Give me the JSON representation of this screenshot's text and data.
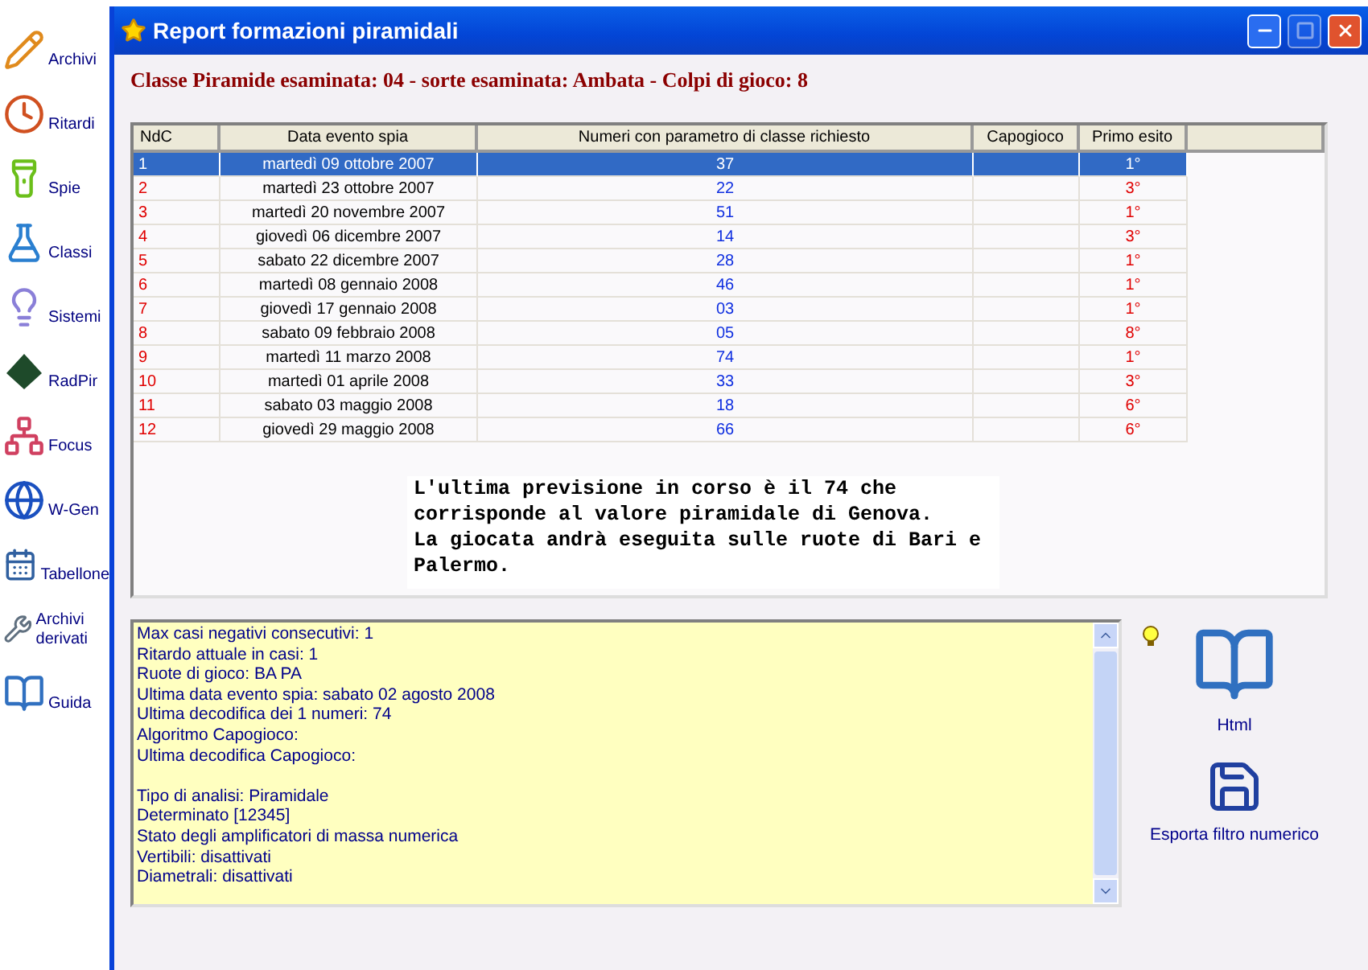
{
  "sidebar": {
    "items": [
      {
        "label": "Archivi"
      },
      {
        "label": "Ritardi"
      },
      {
        "label": "Spie"
      },
      {
        "label": "Classi"
      },
      {
        "label": "Sistemi"
      },
      {
        "label": "RadPir"
      },
      {
        "label": "Focus"
      },
      {
        "label": "W-Gen"
      },
      {
        "label": "Tabellone"
      },
      {
        "label": "Archivi derivati"
      },
      {
        "label": "Guida"
      }
    ]
  },
  "window": {
    "title": "Report formazioni piramidali",
    "buttons": [
      {
        "kind": "minimize",
        "disabled": false
      },
      {
        "kind": "maximize",
        "disabled": true
      },
      {
        "kind": "close",
        "disabled": false
      }
    ]
  },
  "heading": "Classe Piramide esaminata: 04 - sorte esaminata: Ambata - Colpi di gioco: 8",
  "table": {
    "columns": [
      "NdC",
      "Data evento spia",
      "Numeri con parametro di classe richiesto",
      "Capogioco",
      "Primo esito"
    ],
    "rows": [
      {
        "ndc": "1",
        "date": "martedì 09 ottobre 2007",
        "number": "37",
        "result": "1°",
        "selected": true
      },
      {
        "ndc": "2",
        "date": "martedì 23 ottobre 2007",
        "number": "22",
        "result": "3°",
        "selected": false
      },
      {
        "ndc": "3",
        "date": "martedì 20 novembre 2007",
        "number": "51",
        "result": "1°",
        "selected": false
      },
      {
        "ndc": "4",
        "date": "giovedì 06 dicembre 2007",
        "number": "14",
        "result": "3°",
        "selected": false
      },
      {
        "ndc": "5",
        "date": "sabato 22 dicembre 2007",
        "number": "28",
        "result": "1°",
        "selected": false
      },
      {
        "ndc": "6",
        "date": "martedì 08 gennaio 2008",
        "number": "46",
        "result": "1°",
        "selected": false
      },
      {
        "ndc": "7",
        "date": "giovedì 17 gennaio 2008",
        "number": "03",
        "result": "1°",
        "selected": false
      },
      {
        "ndc": "8",
        "date": "sabato 09 febbraio 2008",
        "number": "05",
        "result": "8°",
        "selected": false
      },
      {
        "ndc": "9",
        "date": "martedì 11 marzo 2008",
        "number": "74",
        "result": "1°",
        "selected": false
      },
      {
        "ndc": "10",
        "date": "martedì 01 aprile 2008",
        "number": "33",
        "result": "3°",
        "selected": false
      },
      {
        "ndc": "11",
        "date": "sabato 03 maggio 2008",
        "number": "18",
        "result": "6°",
        "selected": false
      },
      {
        "ndc": "12",
        "date": "giovedì 29 maggio 2008",
        "number": "66",
        "result": "6°",
        "selected": false
      }
    ]
  },
  "forecast_note": "L'ultima previsione in corso è il 74 che corrisponde al valore piramidale di Genova.\nLa giocata andrà eseguita sulle ruote di Bari e Palermo.",
  "summary": {
    "groups": [
      [
        "Max casi negativi consecutivi: 1",
        "Ritardo attuale in casi: 1",
        "Ruote di gioco: BA PA",
        "Ultima data evento spia: sabato 02 agosto 2008",
        "Ultima decodifica dei 1 numeri: 74",
        "Algoritmo Capogioco:",
        "Ultima decodifica Capogioco:"
      ],
      [
        "Tipo di analisi: Piramidale",
        "Determinato [12345]",
        "Stato degli amplificatori di massa numerica",
        "Vertibili: disattivati",
        "Diametrali: disattivati"
      ]
    ]
  },
  "actions": [
    {
      "label": "Html"
    },
    {
      "label": "Esporta filtro numerico"
    }
  ]
}
